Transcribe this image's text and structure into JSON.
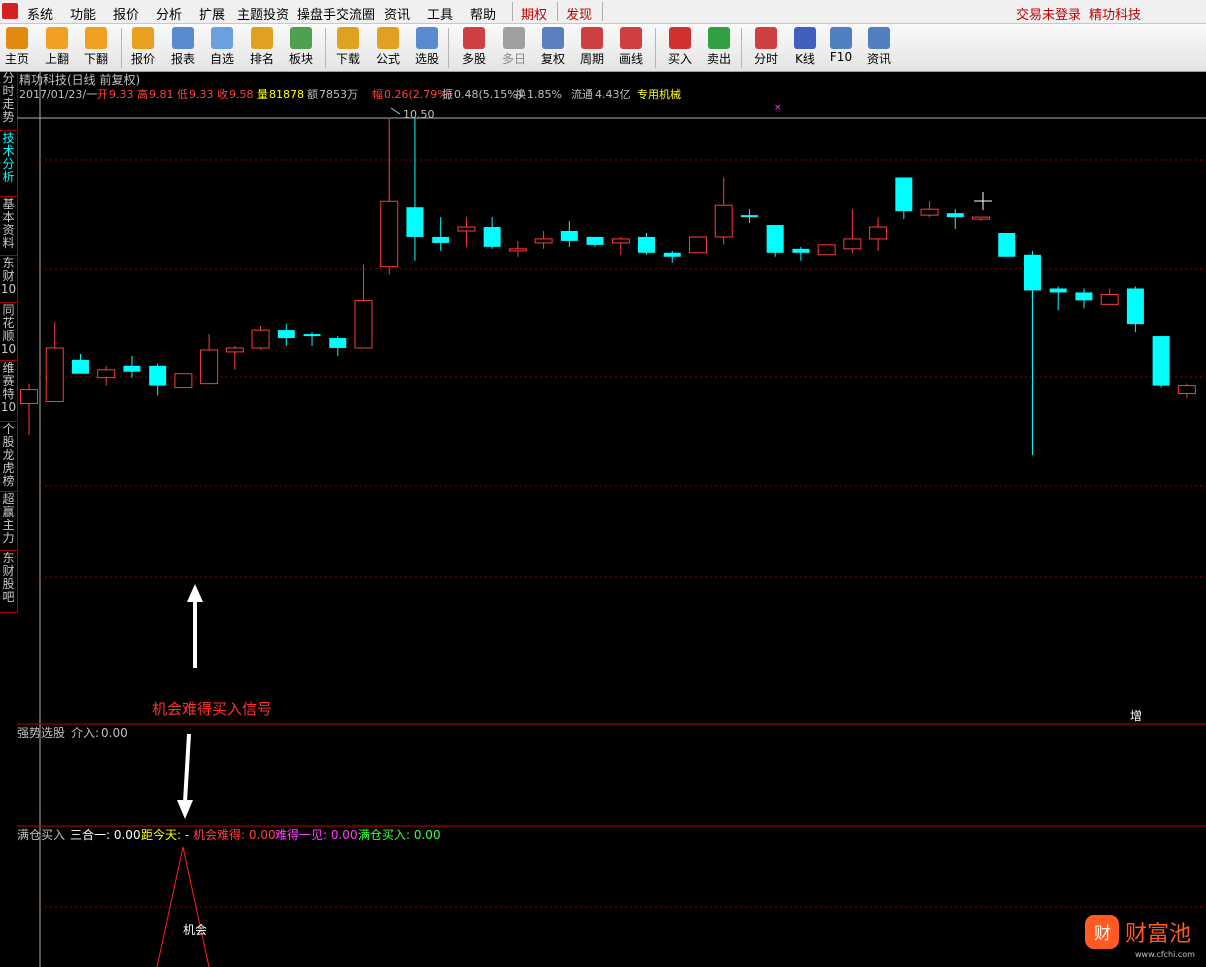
{
  "menu": {
    "items": [
      "系统",
      "功能",
      "报价",
      "分析",
      "扩展",
      "主题投资",
      "操盘手交流圈",
      "资讯",
      "工具",
      "帮助"
    ],
    "special": [
      "期权",
      "发现"
    ],
    "right": [
      "交易未登录",
      "精功科技"
    ]
  },
  "toolbar": {
    "buttons": [
      {
        "label": "主页",
        "icon": "home-icon",
        "color": "#e08a10"
      },
      {
        "label": "上翻",
        "icon": "arrow-up-icon",
        "color": "#f0a020"
      },
      {
        "label": "下翻",
        "icon": "arrow-down-icon",
        "color": "#f0a020"
      },
      {
        "label": "报价",
        "icon": "yen-icon",
        "color": "#e8a020"
      },
      {
        "label": "报表",
        "icon": "report-icon",
        "color": "#5a8ad0"
      },
      {
        "label": "自选",
        "icon": "f6-icon",
        "color": "#6aa0e0"
      },
      {
        "label": "排名",
        "icon": "ranking-icon",
        "color": "#e0a020"
      },
      {
        "label": "板块",
        "icon": "sector-icon",
        "color": "#50a050"
      },
      {
        "label": "下载",
        "icon": "download-icon",
        "color": "#e0a020"
      },
      {
        "label": "公式",
        "icon": "formula-icon",
        "color": "#e0a020"
      },
      {
        "label": "选股",
        "icon": "stock-picker-icon",
        "color": "#5a8ad0"
      },
      {
        "label": "多股",
        "icon": "multi-stock-icon",
        "color": "#d04040"
      },
      {
        "label": "多日",
        "icon": "clock-icon",
        "color": "#a0a0a0"
      },
      {
        "label": "复权",
        "icon": "restore-rights-icon",
        "color": "#5a80c0"
      },
      {
        "label": "周期",
        "icon": "f8-icon",
        "color": "#d04040"
      },
      {
        "label": "画线",
        "icon": "draw-line-icon",
        "color": "#d04040"
      },
      {
        "label": "买入",
        "icon": "buy-icon",
        "color": "#d03030"
      },
      {
        "label": "卖出",
        "icon": "sell-icon",
        "color": "#30a040"
      },
      {
        "label": "分时",
        "icon": "intraday-icon",
        "color": "#d04040"
      },
      {
        "label": "K线",
        "icon": "kline-icon",
        "color": "#4060c0"
      },
      {
        "label": "F10",
        "icon": "f10-icon",
        "color": "#5080c0"
      },
      {
        "label": "资讯",
        "icon": "news-icon",
        "color": "#5080c0"
      }
    ]
  },
  "sidetabs": [
    {
      "label": "分时走势",
      "active": false
    },
    {
      "label": "技术分析",
      "active": true
    },
    {
      "label": "基本资料",
      "active": false
    },
    {
      "label": "东财10",
      "active": false
    },
    {
      "label": "同花顺10",
      "active": false
    },
    {
      "label": "维赛特10",
      "active": false
    },
    {
      "label": "个股龙虎榜",
      "active": false
    },
    {
      "label": "超赢主力",
      "active": false
    },
    {
      "label": "东财股吧",
      "active": false
    }
  ],
  "header": {
    "title": "精功科技(日线 前复权)",
    "date": "2017/01/23/一",
    "open_label": "开",
    "open": "9.33",
    "high_label": "高",
    "high": "9.81",
    "low_label": "低",
    "low": "9.33",
    "close_label": "收",
    "close": "9.58",
    "vol_label": "量",
    "vol": "81878",
    "amount_label": "额",
    "amount": "7853万",
    "range_label": "幅",
    "range": "0.26(2.79%)",
    "amp_label": "振",
    "amp": "0.48(5.15%)",
    "turnover_label": "换",
    "turnover": "1.85%",
    "float_label": "流通",
    "float_cap": "4.43亿",
    "industry": "专用机械",
    "max_price_label": "10.50",
    "ratio_marker": "增"
  },
  "annotation": {
    "text": "机会难得买入信号"
  },
  "panel1": {
    "name": "强势选股",
    "field_label": "介入:",
    "field_value": "0.00"
  },
  "panel2": {
    "name": "满仓买入",
    "fields": [
      {
        "label": "三合一:",
        "value": "0.00",
        "color": "#ffffff"
      },
      {
        "label": "距今天:",
        "value": "-",
        "color": "#ffff00"
      },
      {
        "label": "机会难得:",
        "value": "0.00",
        "color": "#ff4040"
      },
      {
        "label": "难得一见:",
        "value": "0.00",
        "color": "#ff40ff"
      },
      {
        "label": "满仓买入:",
        "value": "0.00",
        "color": "#40ff40"
      }
    ],
    "signal_label": "机会"
  },
  "colors": {
    "up": "#ff3c3c",
    "down": "#00ffff",
    "grid": "#8b0000",
    "text": "#c0c0c0"
  },
  "watermark": {
    "name": "财富池",
    "url": "www.cfchi.com",
    "glyph": "财"
  },
  "chart_data": {
    "type": "candlestick",
    "y_top_label": 10.5,
    "candles": [
      {
        "o": 9.06,
        "h": 9.16,
        "l": 8.9,
        "c": 9.13
      },
      {
        "o": 9.07,
        "h": 9.47,
        "l": 9.07,
        "c": 9.34
      },
      {
        "o": 9.28,
        "h": 9.31,
        "l": 9.21,
        "c": 9.21
      },
      {
        "o": 9.19,
        "h": 9.25,
        "l": 9.15,
        "c": 9.23
      },
      {
        "o": 9.25,
        "h": 9.3,
        "l": 9.19,
        "c": 9.22
      },
      {
        "o": 9.25,
        "h": 9.26,
        "l": 9.1,
        "c": 9.15
      },
      {
        "o": 9.14,
        "h": 9.21,
        "l": 9.14,
        "c": 9.21
      },
      {
        "o": 9.16,
        "h": 9.41,
        "l": 9.16,
        "c": 9.33
      },
      {
        "o": 9.32,
        "h": 9.35,
        "l": 9.23,
        "c": 9.34
      },
      {
        "o": 9.34,
        "h": 9.45,
        "l": 9.33,
        "c": 9.43
      },
      {
        "o": 9.43,
        "h": 9.46,
        "l": 9.35,
        "c": 9.39
      },
      {
        "o": 9.41,
        "h": 9.42,
        "l": 9.35,
        "c": 9.4
      },
      {
        "o": 9.39,
        "h": 9.4,
        "l": 9.3,
        "c": 9.34
      },
      {
        "o": 9.34,
        "h": 9.76,
        "l": 9.34,
        "c": 9.58
      },
      {
        "o": 9.75,
        "h": 10.5,
        "l": 9.71,
        "c": 10.08
      },
      {
        "o": 10.05,
        "h": 10.5,
        "l": 9.78,
        "c": 9.9
      },
      {
        "o": 9.9,
        "h": 10.0,
        "l": 9.83,
        "c": 9.87
      },
      {
        "o": 9.93,
        "h": 10.0,
        "l": 9.85,
        "c": 9.95
      },
      {
        "o": 9.95,
        "h": 10.0,
        "l": 9.84,
        "c": 9.85
      },
      {
        "o": 9.84,
        "h": 9.88,
        "l": 9.8,
        "c": 9.84
      },
      {
        "o": 9.87,
        "h": 9.93,
        "l": 9.84,
        "c": 9.89
      },
      {
        "o": 9.93,
        "h": 9.98,
        "l": 9.85,
        "c": 9.88
      },
      {
        "o": 9.9,
        "h": 9.9,
        "l": 9.85,
        "c": 9.86
      },
      {
        "o": 9.87,
        "h": 9.9,
        "l": 9.81,
        "c": 9.89
      },
      {
        "o": 9.9,
        "h": 9.92,
        "l": 9.81,
        "c": 9.82
      },
      {
        "o": 9.82,
        "h": 9.83,
        "l": 9.77,
        "c": 9.8
      },
      {
        "o": 9.82,
        "h": 9.9,
        "l": 9.82,
        "c": 9.9
      },
      {
        "o": 9.9,
        "h": 10.2,
        "l": 9.86,
        "c": 10.06
      },
      {
        "o": 10.01,
        "h": 10.04,
        "l": 9.97,
        "c": 10.0
      },
      {
        "o": 9.96,
        "h": 9.96,
        "l": 9.8,
        "c": 9.82
      },
      {
        "o": 9.84,
        "h": 9.85,
        "l": 9.78,
        "c": 9.82
      },
      {
        "o": 9.81,
        "h": 9.86,
        "l": 9.81,
        "c": 9.86
      },
      {
        "o": 9.84,
        "h": 10.04,
        "l": 9.82,
        "c": 9.89
      },
      {
        "o": 9.89,
        "h": 10.0,
        "l": 9.83,
        "c": 9.95
      },
      {
        "o": 10.2,
        "h": 10.2,
        "l": 9.99,
        "c": 10.03
      },
      {
        "o": 10.01,
        "h": 10.08,
        "l": 10.0,
        "c": 10.04
      },
      {
        "o": 10.02,
        "h": 10.04,
        "l": 9.94,
        "c": 10.0
      },
      {
        "o": 9.99,
        "h": 10.0,
        "l": 9.98,
        "c": 10.0
      },
      {
        "o": 9.92,
        "h": 9.92,
        "l": 9.8,
        "c": 9.8
      },
      {
        "o": 9.81,
        "h": 9.83,
        "l": 8.8,
        "c": 9.63
      },
      {
        "o": 9.64,
        "h": 9.65,
        "l": 9.53,
        "c": 9.62
      },
      {
        "o": 9.62,
        "h": 9.64,
        "l": 9.54,
        "c": 9.58
      },
      {
        "o": 9.56,
        "h": 9.64,
        "l": 9.56,
        "c": 9.61
      },
      {
        "o": 9.64,
        "h": 9.65,
        "l": 9.42,
        "c": 9.46
      },
      {
        "o": 9.4,
        "h": 9.4,
        "l": 9.14,
        "c": 9.15
      },
      {
        "o": 9.11,
        "h": 9.16,
        "l": 9.09,
        "c": 9.15
      }
    ]
  }
}
